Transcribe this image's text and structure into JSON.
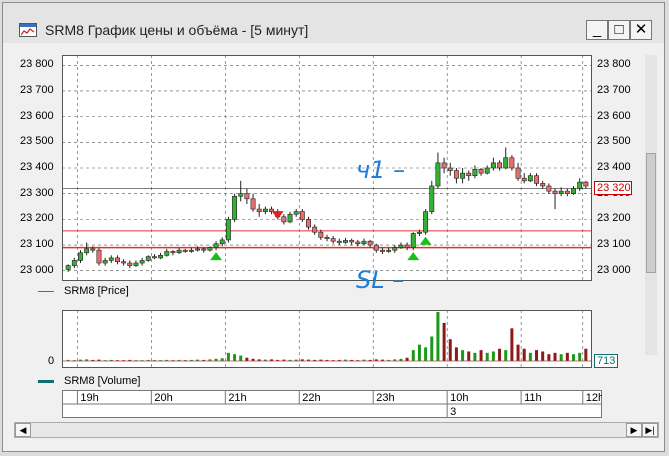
{
  "window": {
    "title": "SRM8 График цены и объёма - [5 минут]"
  },
  "window_buttons": {
    "minimize": "_",
    "maximize": "□",
    "close": "✕"
  },
  "price": {
    "ticks": [
      "23 800",
      "23 700",
      "23 600",
      "23 500",
      "23 400",
      "23 300",
      "23 200",
      "23 100",
      "23 000"
    ],
    "tick_values": [
      23800,
      23700,
      23600,
      23500,
      23400,
      23300,
      23200,
      23100,
      23000
    ],
    "ylim": [
      22960,
      23840
    ],
    "current_label": "23 320",
    "current_value": 23320,
    "levels": {
      "upper": 23155,
      "lower": 23090
    },
    "legend": "SRM8 [Price]"
  },
  "volume": {
    "zero_label": "0",
    "current_label": "713",
    "legend": "SRM8 [Volume]"
  },
  "time": {
    "labels": [
      "19h",
      "20h",
      "21h",
      "22h",
      "23h",
      "10h",
      "11h",
      "12h"
    ],
    "date_label": "3"
  },
  "annotations": {
    "tp": "ч1 –",
    "sl": "SL –"
  },
  "colors": {
    "up": "#35b035",
    "down": "#e86e6e",
    "level": "#e43030",
    "arrow_up": "#18c018",
    "arrow_down": "#e02020",
    "annotation": "#1e7ed8",
    "current_box": "#d00000",
    "volume_box": "#106e6e"
  },
  "chart_data": {
    "type": "candlestick",
    "title": "SRM8 График цены и объёма - [5 минут]",
    "series": [
      {
        "name": "SRM8 [Price]",
        "candles": [
          [
            23005,
            23020,
            22995,
            23025
          ],
          [
            23020,
            23040,
            23010,
            23050
          ],
          [
            23040,
            23070,
            23030,
            23080
          ],
          [
            23070,
            23085,
            23060,
            23110
          ],
          [
            23085,
            23080,
            23070,
            23095
          ],
          [
            23080,
            23030,
            23020,
            23090
          ],
          [
            23030,
            23040,
            23020,
            23050
          ],
          [
            23040,
            23050,
            23030,
            23060
          ],
          [
            23050,
            23035,
            23025,
            23060
          ],
          [
            23035,
            23030,
            23020,
            23045
          ],
          [
            23030,
            23020,
            23010,
            23040
          ],
          [
            23020,
            23030,
            23015,
            23040
          ],
          [
            23030,
            23040,
            23020,
            23050
          ],
          [
            23040,
            23055,
            23035,
            23060
          ],
          [
            23055,
            23050,
            23045,
            23065
          ],
          [
            23050,
            23060,
            23045,
            23070
          ],
          [
            23060,
            23075,
            23055,
            23085
          ],
          [
            23075,
            23070,
            23060,
            23080
          ],
          [
            23070,
            23080,
            23065,
            23090
          ],
          [
            23080,
            23075,
            23070,
            23085
          ],
          [
            23075,
            23080,
            23070,
            23090
          ],
          [
            23080,
            23085,
            23075,
            23095
          ],
          [
            23085,
            23080,
            23070,
            23090
          ],
          [
            23080,
            23090,
            23075,
            23095
          ],
          [
            23090,
            23105,
            23080,
            23115
          ],
          [
            23105,
            23120,
            23095,
            23130
          ],
          [
            23120,
            23200,
            23110,
            23210
          ],
          [
            23200,
            23290,
            23190,
            23300
          ],
          [
            23290,
            23300,
            23270,
            23350
          ],
          [
            23300,
            23280,
            23260,
            23320
          ],
          [
            23280,
            23240,
            23230,
            23300
          ],
          [
            23240,
            23230,
            23210,
            23260
          ],
          [
            23230,
            23240,
            23220,
            23250
          ],
          [
            23240,
            23230,
            23220,
            23250
          ],
          [
            23230,
            23210,
            23200,
            23240
          ],
          [
            23210,
            23190,
            23180,
            23220
          ],
          [
            23190,
            23220,
            23185,
            23230
          ],
          [
            23220,
            23230,
            23210,
            23240
          ],
          [
            23230,
            23200,
            23190,
            23240
          ],
          [
            23200,
            23170,
            23160,
            23210
          ],
          [
            23170,
            23150,
            23140,
            23180
          ],
          [
            23150,
            23130,
            23120,
            23160
          ],
          [
            23130,
            23125,
            23115,
            23140
          ],
          [
            23125,
            23115,
            23105,
            23135
          ],
          [
            23115,
            23110,
            23100,
            23125
          ],
          [
            23110,
            23118,
            23105,
            23128
          ],
          [
            23118,
            23112,
            23100,
            23125
          ],
          [
            23112,
            23105,
            23095,
            23120
          ],
          [
            23105,
            23115,
            23100,
            23125
          ],
          [
            23115,
            23100,
            23090,
            23120
          ],
          [
            23100,
            23080,
            23070,
            23105
          ],
          [
            23080,
            23075,
            23065,
            23090
          ],
          [
            23075,
            23080,
            23070,
            23090
          ],
          [
            23080,
            23090,
            23070,
            23100
          ],
          [
            23090,
            23100,
            23085,
            23110
          ],
          [
            23100,
            23090,
            23080,
            23110
          ],
          [
            23090,
            23145,
            23080,
            23150
          ],
          [
            23145,
            23150,
            23135,
            23160
          ],
          [
            23150,
            23230,
            23140,
            23240
          ],
          [
            23230,
            23330,
            23220,
            23350
          ],
          [
            23330,
            23420,
            23320,
            23460
          ],
          [
            23420,
            23400,
            23380,
            23440
          ],
          [
            23400,
            23390,
            23370,
            23420
          ],
          [
            23390,
            23360,
            23340,
            23400
          ],
          [
            23360,
            23380,
            23340,
            23400
          ],
          [
            23380,
            23370,
            23350,
            23390
          ],
          [
            23370,
            23395,
            23360,
            23410
          ],
          [
            23395,
            23380,
            23370,
            23400
          ],
          [
            23380,
            23400,
            23375,
            23410
          ],
          [
            23400,
            23420,
            23390,
            23440
          ],
          [
            23420,
            23400,
            23390,
            23430
          ],
          [
            23400,
            23440,
            23395,
            23480
          ],
          [
            23440,
            23400,
            23390,
            23450
          ],
          [
            23400,
            23360,
            23350,
            23420
          ],
          [
            23360,
            23350,
            23340,
            23380
          ],
          [
            23350,
            23370,
            23345,
            23380
          ],
          [
            23370,
            23340,
            23330,
            23380
          ],
          [
            23340,
            23330,
            23320,
            23350
          ],
          [
            23330,
            23310,
            23300,
            23340
          ],
          [
            23310,
            23300,
            23240,
            23320
          ],
          [
            23300,
            23310,
            23290,
            23325
          ],
          [
            23310,
            23300,
            23290,
            23320
          ],
          [
            23300,
            23320,
            23295,
            23330
          ],
          [
            23320,
            23345,
            23310,
            23360
          ],
          [
            23345,
            23330,
            23320,
            23350
          ]
        ]
      },
      {
        "name": "SRM8 [Volume]",
        "values": [
          4,
          3,
          5,
          6,
          4,
          5,
          3,
          4,
          3,
          3,
          4,
          3,
          3,
          4,
          3,
          3,
          4,
          3,
          4,
          3,
          4,
          5,
          4,
          6,
          8,
          10,
          30,
          25,
          20,
          12,
          8,
          6,
          5,
          6,
          4,
          5,
          4,
          5,
          6,
          5,
          4,
          5,
          4,
          3,
          4,
          5,
          4,
          3,
          5,
          4,
          6,
          5,
          4,
          6,
          8,
          12,
          40,
          60,
          50,
          90,
          180,
          140,
          80,
          50,
          40,
          35,
          30,
          40,
          30,
          35,
          45,
          40,
          120,
          60,
          45,
          30,
          40,
          35,
          25,
          30,
          25,
          30,
          25,
          30,
          45
        ]
      }
    ],
    "volume_max": 180,
    "time_axis": [
      "19h",
      "20h",
      "21h",
      "22h",
      "23h",
      "10h",
      "11h",
      "12h"
    ]
  }
}
